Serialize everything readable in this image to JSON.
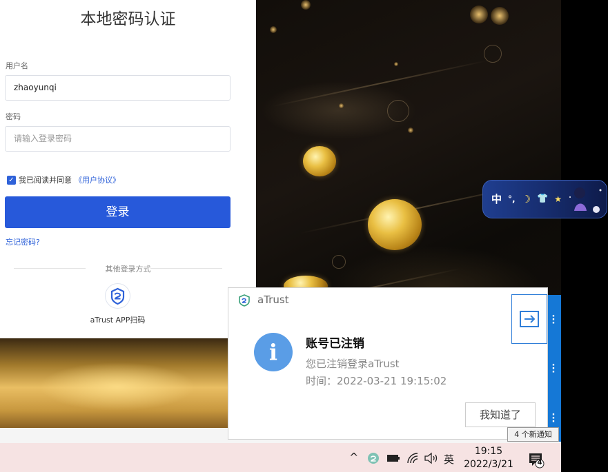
{
  "login": {
    "title": "本地密码认证",
    "username_label": "用户名",
    "username_value": "zhaoyunqi",
    "password_label": "密码",
    "password_placeholder": "请输入登录密码",
    "agree_text": "我已阅读并同意",
    "agree_link": "《用户协议》",
    "agree_checked": true,
    "submit_label": "登录",
    "forgot_label": "忘记密码?",
    "other_methods_label": "其他登录方式",
    "atrust_scan_label": "aTrust APP扫码",
    "accent_color": "#2759da"
  },
  "ime": {
    "mode": "中",
    "items": [
      "°,",
      "☽",
      "👕",
      "★"
    ]
  },
  "notification": {
    "app_name": "aTrust",
    "title": "账号已注销",
    "body": "您已注销登录aTrust",
    "time_text": "时间：2022-03-21 19:15:02",
    "ack_label": "我知道了",
    "icon": "info-icon"
  },
  "tooltip": {
    "text": "4 个新通知"
  },
  "taskbar": {
    "show_hidden_icon": "^",
    "ime_lang": "英",
    "volume_icon": "speaker-icon",
    "time": "19:15",
    "date": "2022/3/21",
    "notification_count": "4"
  }
}
